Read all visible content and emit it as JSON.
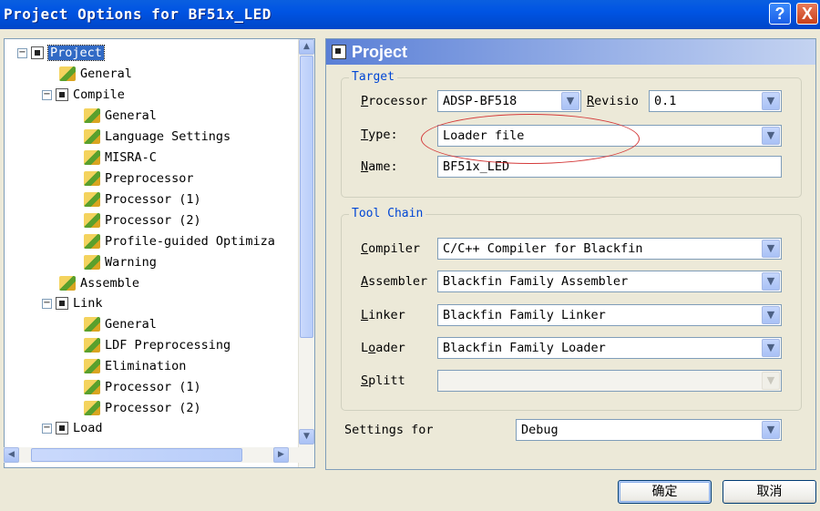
{
  "window": {
    "title": "Project Options for BF51x_LED",
    "help_glyph": "?",
    "close_glyph": "X"
  },
  "tree": {
    "items": [
      {
        "label": "Project"
      },
      {
        "label": "General"
      },
      {
        "label": "Compile"
      },
      {
        "label": "General"
      },
      {
        "label": "Language Settings"
      },
      {
        "label": "MISRA-C"
      },
      {
        "label": "Preprocessor"
      },
      {
        "label": "Processor (1)"
      },
      {
        "label": "Processor (2)"
      },
      {
        "label": "Profile-guided Optimiza"
      },
      {
        "label": "Warning"
      },
      {
        "label": "Assemble"
      },
      {
        "label": "Link"
      },
      {
        "label": "General"
      },
      {
        "label": "LDF Preprocessing"
      },
      {
        "label": "Elimination"
      },
      {
        "label": "Processor (1)"
      },
      {
        "label": "Processor (2)"
      },
      {
        "label": "Load"
      }
    ],
    "scroll_up": "▲",
    "scroll_down": "▼",
    "scroll_left": "◀",
    "scroll_right": "▶"
  },
  "panel": {
    "title": "Project",
    "target": {
      "group_title": "Target",
      "processor_label_u": "P",
      "processor_label_rest": "rocessor",
      "processor_value": "ADSP-BF518",
      "revision_label_u": "R",
      "revision_label_rest": "evisio",
      "revision_value": "0.1",
      "type_label_u": "T",
      "type_label_rest": "ype:",
      "type_value": "Loader file",
      "name_label_u": "N",
      "name_label_rest": "ame:",
      "name_value": "BF51x_LED"
    },
    "toolchain": {
      "group_title": "Tool Chain",
      "compiler_label_u": "C",
      "compiler_label_rest": "ompiler",
      "compiler_value": "C/C++ Compiler for Blackfin",
      "assembler_label_u": "A",
      "assembler_label_rest": "ssembler",
      "assembler_value": "Blackfin Family Assembler",
      "linker_label_u": "L",
      "linker_label_rest": "inker",
      "linker_value": "Blackfin Family Linker",
      "loader_label_pre": "L",
      "loader_label_u": "o",
      "loader_label_rest": "ader",
      "loader_value": "Blackfin Family Loader",
      "splitter_label_u": "S",
      "splitter_label_rest": "plitt",
      "splitter_value": ""
    },
    "settings_for_label": "Settings for",
    "settings_for_value": "Debug"
  },
  "buttons": {
    "ok": "确定",
    "cancel": "取消"
  },
  "dropdown_glyph": "▼",
  "colors": {
    "annotation_ellipse": "#d43a3a",
    "group_title": "#0046d5",
    "selection": "#316ac5"
  }
}
